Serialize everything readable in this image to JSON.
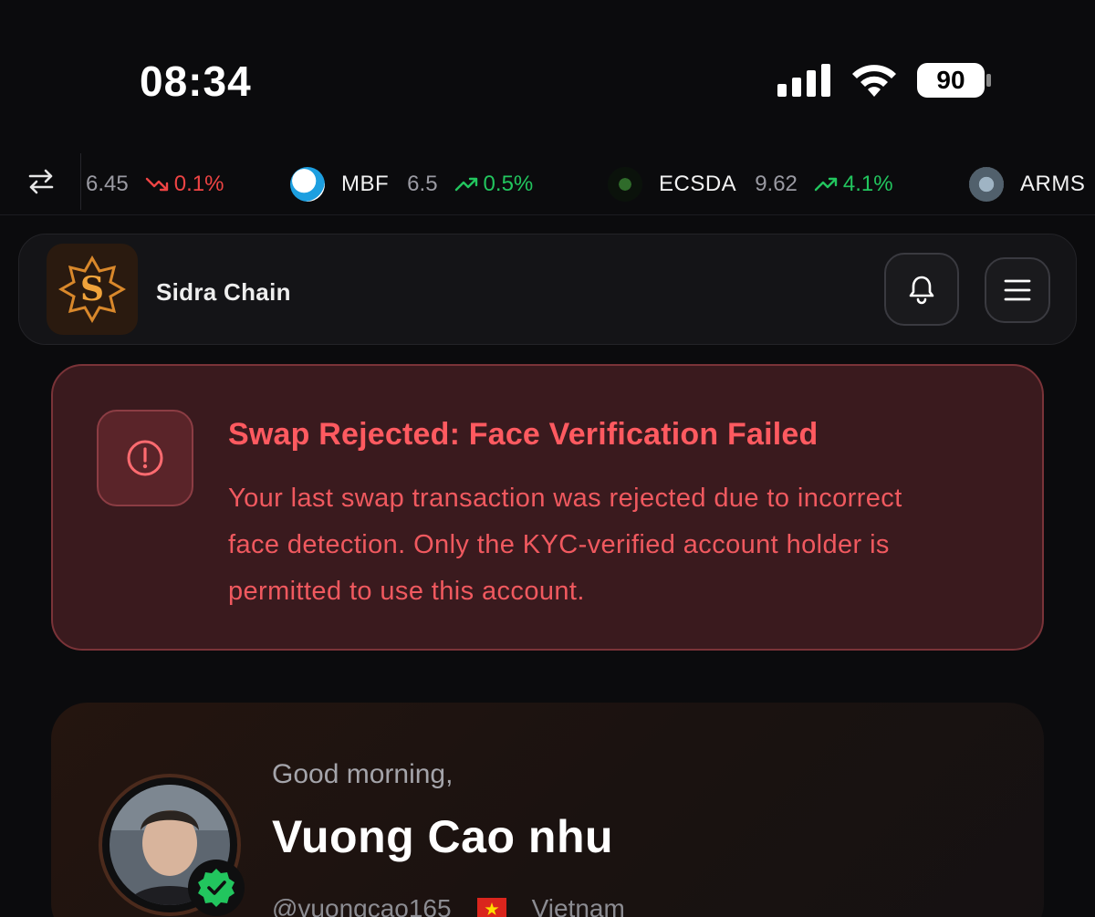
{
  "status_bar": {
    "time": "08:34",
    "battery_level": "90"
  },
  "ticker": {
    "items": [
      {
        "symbol": "",
        "price": "6.45",
        "change": "0.1%",
        "direction": "down"
      },
      {
        "symbol": "MBF",
        "price": "6.5",
        "change": "0.5%",
        "direction": "up"
      },
      {
        "symbol": "ECSDA",
        "price": "9.62",
        "change": "4.1%",
        "direction": "up"
      },
      {
        "symbol": "ARMS",
        "price": "",
        "change": "",
        "direction": ""
      }
    ]
  },
  "header": {
    "brand_name": "Sidra Chain"
  },
  "alert": {
    "title": "Swap Rejected: Face Verification Failed",
    "body": "Your last swap transaction was rejected due to incorrect face detection. Only the KYC-verified account holder is permitted to use this account."
  },
  "profile": {
    "greeting": "Good morning,",
    "name": "Vuong Cao nhu",
    "handle": "@vuongcao165",
    "country": "Vietnam"
  },
  "colors": {
    "background": "#0b0b0d",
    "alert_text": "#ff5a60",
    "up": "#22c55e",
    "down": "#ef4444",
    "brand_accent": "#e8902a"
  },
  "icons": {
    "swap": "swap-arrows-icon",
    "bell": "bell-icon",
    "menu": "hamburger-menu-icon",
    "alert": "exclamation-circle-icon",
    "verified": "verified-check-icon"
  }
}
